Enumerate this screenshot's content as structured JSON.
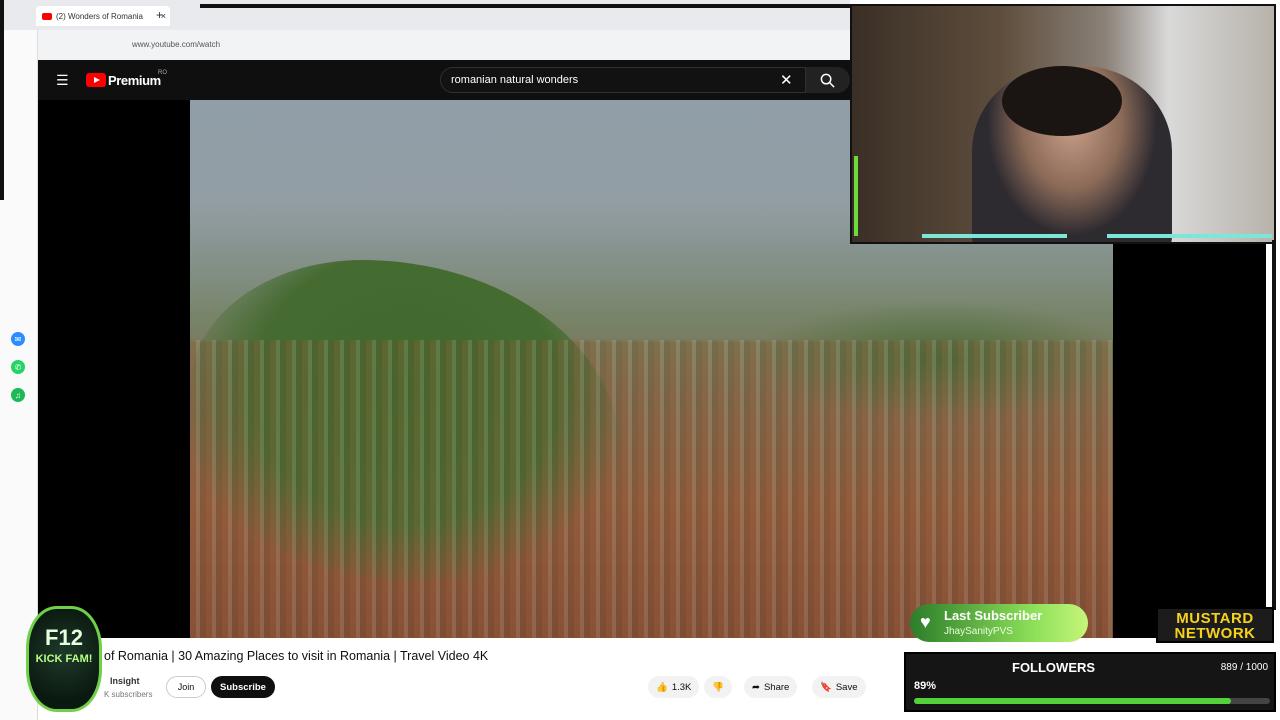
{
  "browser": {
    "tab_title": "(2) Wonders of Romania",
    "url": "www.youtube.com/watch",
    "new_tab": "+"
  },
  "youtube": {
    "brand": "Premium",
    "region": "RO",
    "search_query": "romanian natural wonders",
    "video_title": "of Romania | 30 Amazing Places to visit in Romania | Travel Video 4K",
    "channel_name": "Insight",
    "subscribers": "K subscribers",
    "join_label": "Join",
    "subscribe_label": "Subscribe",
    "likes": "1.3K",
    "share_label": "Share",
    "save_label": "Save"
  },
  "overlay": {
    "last_subscriber_title": "Last Subscriber",
    "last_subscriber_name": "JhaySanityPVS",
    "network_line1": "MUSTARD",
    "network_line2": "NETWORK",
    "followers_title": "FOLLOWERS",
    "followers_count": "889 / 1000",
    "followers_percent": "89%",
    "followers_progress": 0.89,
    "badge_line1": "F12",
    "badge_line2": "KICK FAM!"
  },
  "colors": {
    "youtube_red": "#ff0000",
    "accent_green": "#55d23a",
    "mustard": "#f7d21c"
  },
  "icons": {
    "menu": "hamburger-icon",
    "search": "search-icon",
    "clear": "close-icon",
    "like": "thumbs-up-icon",
    "dislike": "thumbs-down-icon",
    "share": "share-icon",
    "save": "bookmark-icon"
  }
}
